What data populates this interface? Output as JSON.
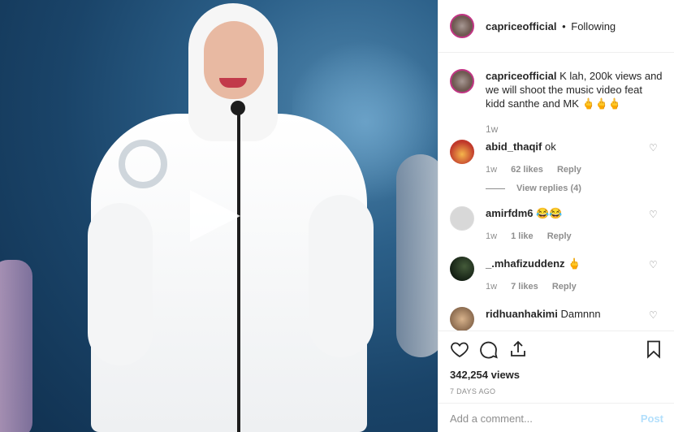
{
  "post": {
    "username": "capriceofficial",
    "follow_status": "Following",
    "separator": "•",
    "caption_user": "capriceofficial",
    "caption_text": "K lah, 200k views and we will shoot the music video feat kidd santhe and MK 🖕🖕🖕",
    "caption_time": "1w",
    "views": "342,254 views",
    "time_ago": "7 DAYS AGO"
  },
  "comments": [
    {
      "user": "abid_thaqif",
      "text": "ok",
      "time": "1w",
      "likes": "62 likes",
      "reply": "Reply",
      "view_replies": "View replies (4)"
    },
    {
      "user": "amirfdm6",
      "text": "😂😂",
      "time": "1w",
      "likes": "1 like",
      "reply": "Reply"
    },
    {
      "user": "_.mhafizuddenz",
      "text": "🖕",
      "time": "1w",
      "likes": "7 likes",
      "reply": "Reply"
    },
    {
      "user": "ridhuanhakimi",
      "text": "Damnnn"
    }
  ],
  "composer": {
    "placeholder": "Add a comment...",
    "post_label": "Post"
  },
  "icons": {
    "heart": "heart-icon",
    "comment": "comment-icon",
    "share": "share-icon",
    "save": "bookmark-icon",
    "play": "play-icon"
  }
}
